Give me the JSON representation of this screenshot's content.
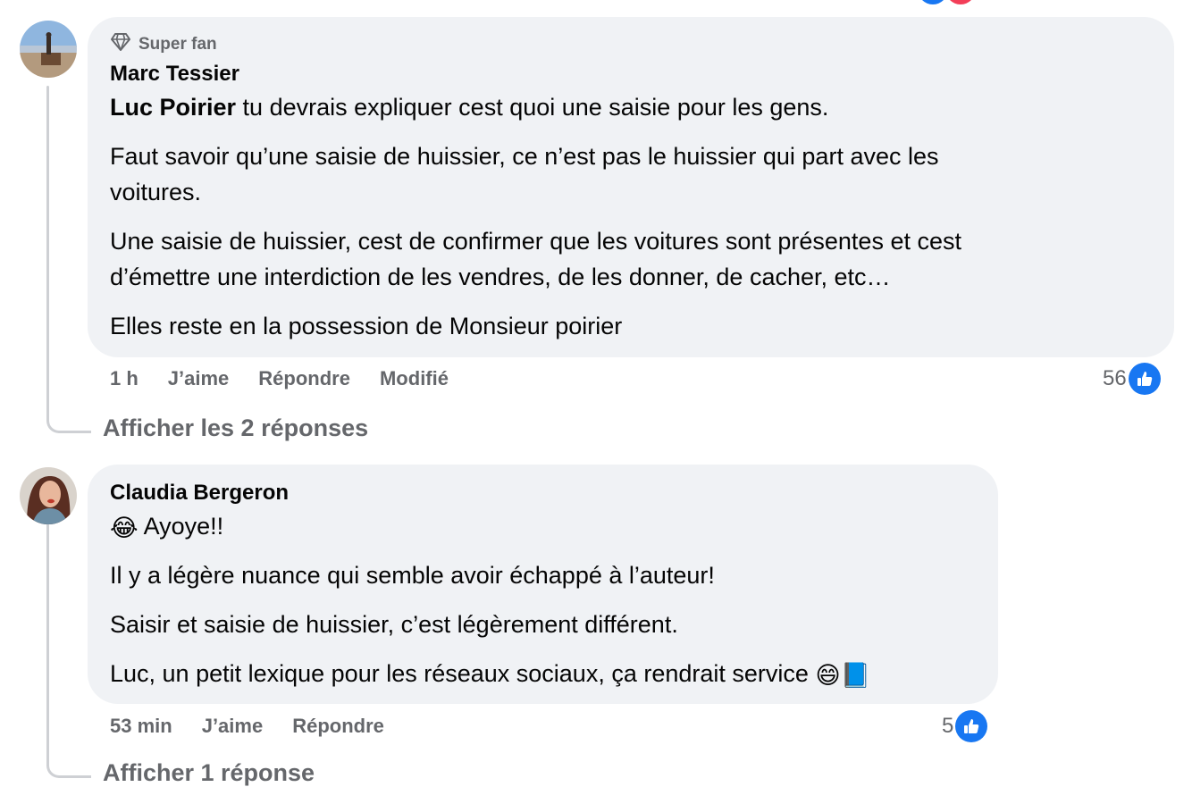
{
  "colors": {
    "bubble": "#f0f2f5",
    "secondary_text": "#65676b",
    "like_blue": "#1877f2",
    "love_red": "#f33e58"
  },
  "comment1": {
    "badge_icon": "diamond-icon",
    "badge": "Super fan",
    "author": "Marc Tessier",
    "mention": "Luc Poirier",
    "para1_rest": " tu devrais expliquer cest quoi une saisie pour les gens.",
    "para2_line1": "Faut savoir qu’une saisie de huissier, ce n’est pas le huissier qui part avec les",
    "para2_line2": "voitures.",
    "para3_line1": "Une saisie de huissier, cest de confirmer que les voitures sont présentes et cest",
    "para3_line2": "d’émettre une interdiction de les vendres, de les donner, de cacher, etc…",
    "para4": "Elles reste en la possession de Monsieur poirier",
    "time": "1 h",
    "like_label": "J’aime",
    "reply_label": "Répondre",
    "edited_label": "Modifié",
    "like_count": "56",
    "view_replies": "Afficher les 2 réponses"
  },
  "comment2": {
    "author": "Claudia Bergeron",
    "para1": "Ayoye!!",
    "para1_emoji": "😂",
    "para2": "Il y a légère nuance qui semble avoir échappé à l’auteur!",
    "para3": "Saisir et saisie de huissier, c’est légèrement différent.",
    "para4": "Luc, un petit lexique pour les réseaux sociaux, ça rendrait service",
    "para4_emojis": "😄📘",
    "time": "53 min",
    "like_label": "J’aime",
    "reply_label": "Répondre",
    "like_count": "5",
    "view_replies": "Afficher 1 réponse"
  }
}
